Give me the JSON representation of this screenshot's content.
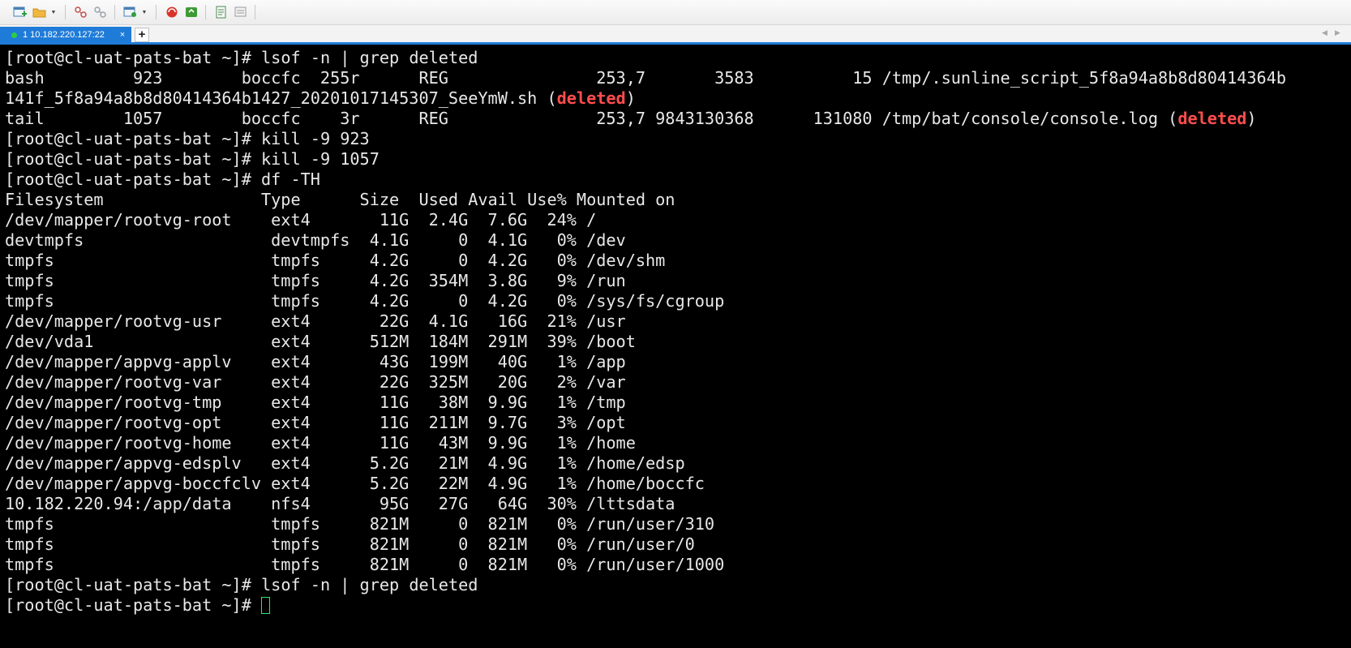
{
  "toolbar": {
    "icons": [
      "new-session-icon",
      "open-folder-icon",
      "disconnect-icon",
      "reconnect-icon",
      "session-properties-icon",
      "xshell-logo-icon",
      "xftp-icon",
      "script-icon",
      "compose-icon"
    ]
  },
  "tabs": [
    {
      "label": "1 10.182.220.127:22",
      "close": "×",
      "status_color": "#2ecc40"
    }
  ],
  "tab_add_label": "+",
  "tab_nav": {
    "prev": "◀",
    "next": "▶"
  },
  "terminal": {
    "prompt": "[root@cl-uat-pats-bat ~]# ",
    "deleted_word": "deleted",
    "commands": {
      "lsof": "lsof -n | grep deleted",
      "kill1": "kill -9 923",
      "kill2": "kill -9 1057",
      "df": "df -TH"
    },
    "lsof_rows": {
      "bash_line1": "bash         923        boccfc  255r      REG               253,7       3583          15 /tmp/.sunline_script_5f8a94a8b8d80414364b",
      "bash_line2_text": "141f_5f8a94a8b8d80414364b1427_20201017145307_SeeYmW.sh (",
      "tail_line_text": "tail        1057        boccfc    3r      REG               253,7 9843130368      131080 /tmp/bat/console/console.log ("
    },
    "df_header": "Filesystem                Type      Size  Used Avail Use% Mounted on",
    "df_rows": [
      "/dev/mapper/rootvg-root    ext4       11G  2.4G  7.6G  24% /",
      "devtmpfs                   devtmpfs  4.1G     0  4.1G   0% /dev",
      "tmpfs                      tmpfs     4.2G     0  4.2G   0% /dev/shm",
      "tmpfs                      tmpfs     4.2G  354M  3.8G   9% /run",
      "tmpfs                      tmpfs     4.2G     0  4.2G   0% /sys/fs/cgroup",
      "/dev/mapper/rootvg-usr     ext4       22G  4.1G   16G  21% /usr",
      "/dev/vda1                  ext4      512M  184M  291M  39% /boot",
      "/dev/mapper/appvg-applv    ext4       43G  199M   40G   1% /app",
      "/dev/mapper/rootvg-var     ext4       22G  325M   20G   2% /var",
      "/dev/mapper/rootvg-tmp     ext4       11G   38M  9.9G   1% /tmp",
      "/dev/mapper/rootvg-opt     ext4       11G  211M  9.7G   3% /opt",
      "/dev/mapper/rootvg-home    ext4       11G   43M  9.9G   1% /home",
      "/dev/mapper/appvg-edsplv   ext4      5.2G   21M  4.9G   1% /home/edsp",
      "/dev/mapper/appvg-boccfclv ext4      5.2G   22M  4.9G   1% /home/boccfc",
      "10.182.220.94:/app/data    nfs4       95G   27G   64G  30% /lttsdata",
      "tmpfs                      tmpfs     821M     0  821M   0% /run/user/310",
      "tmpfs                      tmpfs     821M     0  821M   0% /run/user/0",
      "tmpfs                      tmpfs     821M     0  821M   0% /run/user/1000"
    ]
  },
  "colors": {
    "tab_active": "#1f7bd8",
    "deleted_text": "#ff4d4d",
    "cursor": "#2ee86a",
    "terminal_bg": "#000000"
  }
}
